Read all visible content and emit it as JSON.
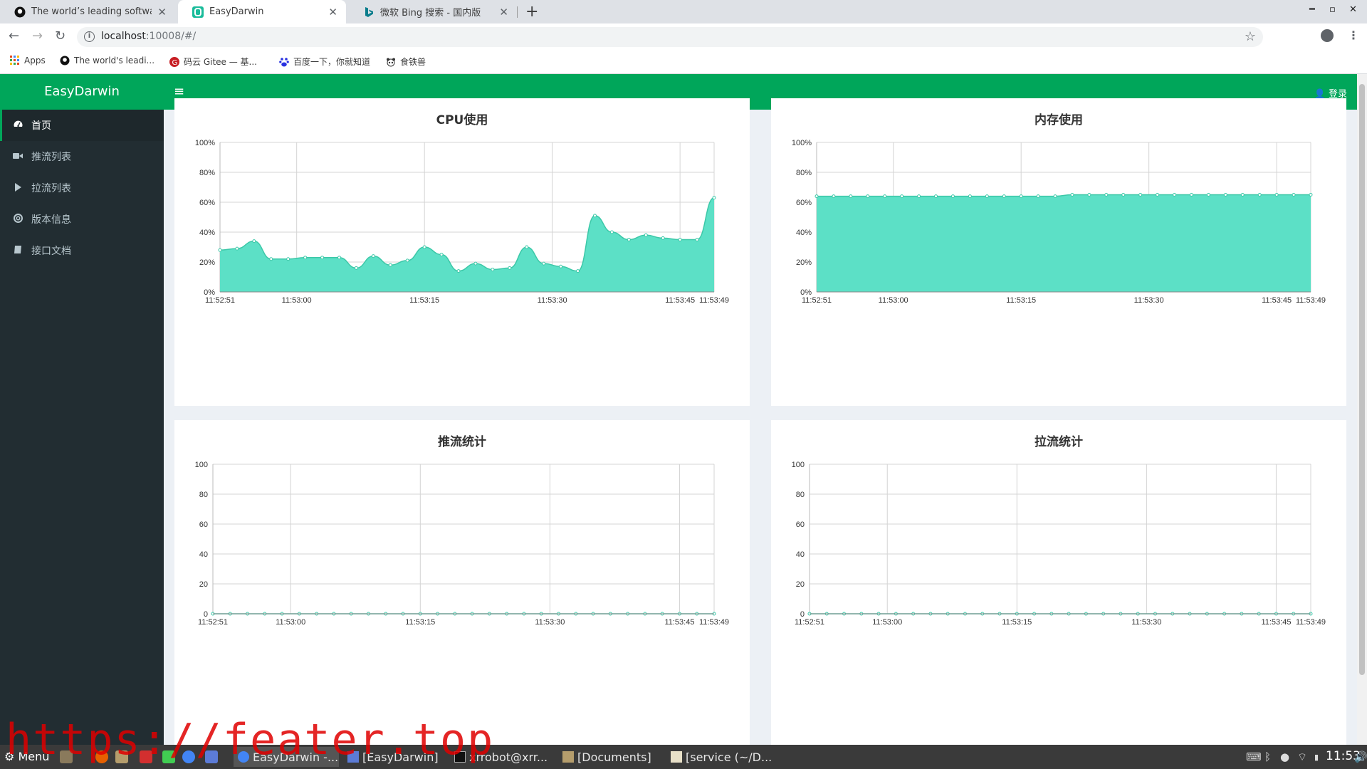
{
  "browser": {
    "tabs": [
      {
        "title": "The world’s leading software",
        "active": false
      },
      {
        "title": "EasyDarwin",
        "active": true
      },
      {
        "title": "微软 Bing 搜索 - 国内版",
        "active": false
      }
    ],
    "url_host": "localhost",
    "url_rest": ":10008/#/",
    "bookmarks": [
      "Apps",
      "The world's leadi...",
      "码云 Gitee — 基...",
      "百度一下，你就知道",
      "食铁兽"
    ]
  },
  "app": {
    "brand": "EasyDarwin",
    "login_label": "登录",
    "menu": [
      {
        "label": "首页",
        "icon": "dashboard-icon",
        "active": true
      },
      {
        "label": "推流列表",
        "icon": "video-camera-icon",
        "active": false
      },
      {
        "label": "拉流列表",
        "icon": "play-icon",
        "active": false
      },
      {
        "label": "版本信息",
        "icon": "support-icon",
        "active": false
      },
      {
        "label": "接口文档",
        "icon": "book-icon",
        "active": false
      }
    ],
    "accent_color": "#00a65a",
    "chart_fill": "#5ce0c6",
    "chart_line": "#3cc8a8"
  },
  "chart_data": [
    {
      "type": "area",
      "title": "CPU使用",
      "x_ticks": [
        "11:52:51",
        "11:53:00",
        "11:53:15",
        "11:53:30",
        "11:53:45",
        "11:53:49"
      ],
      "y_ticks": [
        "0%",
        "20%",
        "40%",
        "60%",
        "80%",
        "100%"
      ],
      "ylim": [
        0,
        100
      ],
      "x_seconds": [
        0,
        9,
        24,
        39,
        54,
        58
      ],
      "values": [
        28,
        29,
        34,
        22,
        22,
        23,
        23,
        23,
        16,
        24,
        18,
        21,
        30,
        25,
        14,
        19,
        15,
        16,
        30,
        19,
        17,
        14,
        51,
        40,
        35,
        38,
        36,
        35,
        35,
        63
      ]
    },
    {
      "type": "area",
      "title": "内存使用",
      "x_ticks": [
        "11:52:51",
        "11:53:00",
        "11:53:15",
        "11:53:30",
        "11:53:45",
        "11:53:49"
      ],
      "y_ticks": [
        "0%",
        "20%",
        "40%",
        "60%",
        "80%",
        "100%"
      ],
      "ylim": [
        0,
        100
      ],
      "x_seconds": [
        0,
        9,
        24,
        39,
        54,
        58
      ],
      "values": [
        64,
        64,
        64,
        64,
        64,
        64,
        64,
        64,
        64,
        64,
        64,
        64,
        64,
        64,
        64,
        65,
        65,
        65,
        65,
        65,
        65,
        65,
        65,
        65,
        65,
        65,
        65,
        65,
        65,
        65
      ]
    },
    {
      "type": "line",
      "title": "推流统计",
      "x_ticks": [
        "11:52:51",
        "11:53:00",
        "11:53:15",
        "11:53:30",
        "11:53:45",
        "11:53:49"
      ],
      "y_ticks": [
        "0",
        "20",
        "40",
        "60",
        "80",
        "100"
      ],
      "ylim": [
        0,
        100
      ],
      "x_seconds": [
        0,
        9,
        24,
        39,
        54,
        58
      ],
      "values": [
        0,
        0,
        0,
        0,
        0,
        0,
        0,
        0,
        0,
        0,
        0,
        0,
        0,
        0,
        0,
        0,
        0,
        0,
        0,
        0,
        0,
        0,
        0,
        0,
        0,
        0,
        0,
        0,
        0,
        0
      ]
    },
    {
      "type": "line",
      "title": "拉流统计",
      "x_ticks": [
        "11:52:51",
        "11:53:00",
        "11:53:15",
        "11:53:30",
        "11:53:45",
        "11:53:49"
      ],
      "y_ticks": [
        "0",
        "20",
        "40",
        "60",
        "80",
        "100"
      ],
      "ylim": [
        0,
        100
      ],
      "x_seconds": [
        0,
        9,
        24,
        39,
        54,
        58
      ],
      "values": [
        0,
        0,
        0,
        0,
        0,
        0,
        0,
        0,
        0,
        0,
        0,
        0,
        0,
        0,
        0,
        0,
        0,
        0,
        0,
        0,
        0,
        0,
        0,
        0,
        0,
        0,
        0,
        0,
        0,
        0
      ]
    }
  ],
  "taskbar": {
    "menu_label": "Menu",
    "tasks": [
      "EasyDarwin -...",
      "[EasyDarwin]",
      "xrrobot@xrr...",
      "[Documents]",
      "[service (~/D..."
    ],
    "clock": "11:53"
  },
  "watermark": "https://feater.top"
}
